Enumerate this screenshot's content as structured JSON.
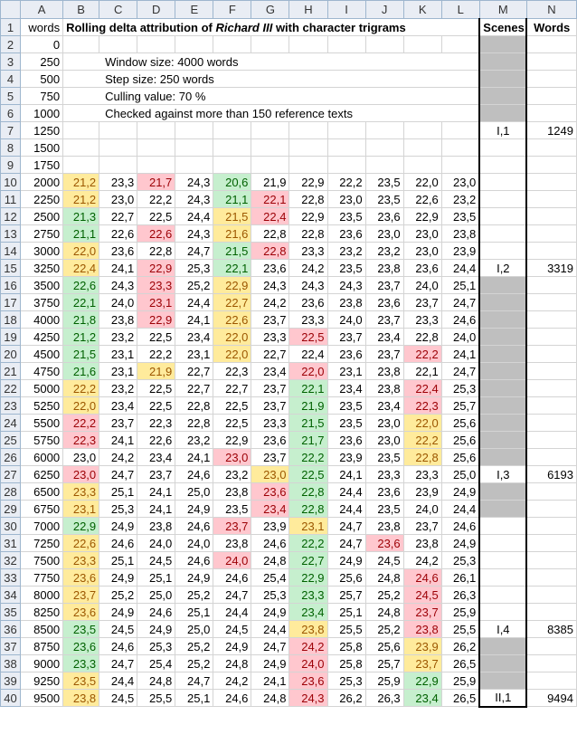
{
  "columns": [
    "A",
    "B",
    "C",
    "D",
    "E",
    "F",
    "G",
    "H",
    "I",
    "J",
    "K",
    "L",
    "M",
    "N"
  ],
  "header": {
    "words": "words",
    "title_pre": "Rolling delta attribution of ",
    "title_em": "Richard III",
    "title_post": " with character trigrams",
    "scenes": "Scenes",
    "words_col": "Words"
  },
  "notes": {
    "window": "Window size: 4000 words",
    "step": "Step size: 250 words",
    "culling": "Culling value: 70 %",
    "checked": "Checked against more than 150 reference texts"
  },
  "colors": {
    "green": "#c6efce",
    "yellow": "#ffeb9c",
    "red": "#ffc7ce",
    "grey": "#bfbfbf"
  },
  "rows": [
    {
      "n": "2",
      "w": "0",
      "v": [],
      "c": "",
      "scene": "",
      "sw": ""
    },
    {
      "n": "3",
      "w": "250",
      "v": [],
      "c": "",
      "scene": "",
      "sw": ""
    },
    {
      "n": "4",
      "w": "500",
      "v": [],
      "c": "",
      "scene": "",
      "sw": ""
    },
    {
      "n": "5",
      "w": "750",
      "v": [],
      "c": "",
      "scene": "",
      "sw": ""
    },
    {
      "n": "6",
      "w": "1000",
      "v": [],
      "c": "",
      "scene": "",
      "sw": ""
    },
    {
      "n": "7",
      "w": "1250",
      "v": [],
      "c": "",
      "scene": "I,1",
      "sw": "1249"
    },
    {
      "n": "8",
      "w": "1500",
      "v": [],
      "c": "",
      "scene": "",
      "sw": ""
    },
    {
      "n": "9",
      "w": "1750",
      "v": [],
      "c": "",
      "scene": "",
      "sw": ""
    },
    {
      "n": "10",
      "w": "2000",
      "v": [
        "21,2",
        "23,3",
        "21,7",
        "24,3",
        "20,6",
        "21,9",
        "22,9",
        "22,2",
        "23,5",
        "22,0",
        "23,0"
      ],
      "c": "y.r.g......",
      "scene": "",
      "sw": ""
    },
    {
      "n": "11",
      "w": "2250",
      "v": [
        "21,2",
        "23,0",
        "22,2",
        "24,3",
        "21,1",
        "22,1",
        "22,8",
        "23,0",
        "23,5",
        "22,6",
        "23,2"
      ],
      "c": "y...gr.....",
      "scene": "",
      "sw": ""
    },
    {
      "n": "12",
      "w": "2500",
      "v": [
        "21,3",
        "22,7",
        "22,5",
        "24,4",
        "21,5",
        "22,4",
        "22,9",
        "23,5",
        "23,6",
        "22,9",
        "23,5"
      ],
      "c": "g...yr.....",
      "scene": "",
      "sw": ""
    },
    {
      "n": "13",
      "w": "2750",
      "v": [
        "21,1",
        "22,6",
        "22,6",
        "24,3",
        "21,6",
        "22,8",
        "22,8",
        "23,6",
        "23,0",
        "23,0",
        "23,8"
      ],
      "c": "g.r.y......",
      "scene": "",
      "sw": ""
    },
    {
      "n": "14",
      "w": "3000",
      "v": [
        "22,0",
        "23,6",
        "22,8",
        "24,7",
        "21,5",
        "22,8",
        "23,3",
        "23,2",
        "23,2",
        "23,0",
        "23,9"
      ],
      "c": "y...gr.....",
      "scene": "",
      "sw": ""
    },
    {
      "n": "15",
      "w": "3250",
      "v": [
        "22,4",
        "24,1",
        "22,9",
        "25,3",
        "22,1",
        "23,6",
        "24,2",
        "23,5",
        "23,8",
        "23,6",
        "24,4"
      ],
      "c": "y.r.g......",
      "scene": "I,2",
      "sw": "3319"
    },
    {
      "n": "16",
      "w": "3500",
      "v": [
        "22,6",
        "24,3",
        "23,3",
        "25,2",
        "22,9",
        "24,3",
        "24,3",
        "24,3",
        "23,7",
        "24,0",
        "25,1"
      ],
      "c": "g.r.y......",
      "scene": "",
      "sw": ""
    },
    {
      "n": "17",
      "w": "3750",
      "v": [
        "22,1",
        "24,0",
        "23,1",
        "24,4",
        "22,7",
        "24,2",
        "23,6",
        "23,8",
        "23,6",
        "23,7",
        "24,7"
      ],
      "c": "g.r.y......",
      "scene": "",
      "sw": ""
    },
    {
      "n": "18",
      "w": "4000",
      "v": [
        "21,8",
        "23,8",
        "22,9",
        "24,1",
        "22,6",
        "23,7",
        "23,3",
        "24,0",
        "23,7",
        "23,3",
        "24,6"
      ],
      "c": "g.r.y......",
      "scene": "",
      "sw": ""
    },
    {
      "n": "19",
      "w": "4250",
      "v": [
        "21,2",
        "23,2",
        "22,5",
        "23,4",
        "22,0",
        "23,3",
        "22,5",
        "23,7",
        "23,4",
        "22,8",
        "24,0"
      ],
      "c": "g...y.r....",
      "scene": "",
      "sw": ""
    },
    {
      "n": "20",
      "w": "4500",
      "v": [
        "21,5",
        "23,1",
        "22,2",
        "23,1",
        "22,0",
        "22,7",
        "22,4",
        "23,6",
        "23,7",
        "22,2",
        "24,1"
      ],
      "c": "g...y....r.",
      "scene": "",
      "sw": ""
    },
    {
      "n": "21",
      "w": "4750",
      "v": [
        "21,6",
        "23,1",
        "21,9",
        "22,7",
        "22,3",
        "23,4",
        "22,0",
        "23,1",
        "23,8",
        "22,1",
        "24,7"
      ],
      "c": "g.y...r....",
      "scene": "",
      "sw": ""
    },
    {
      "n": "22",
      "w": "5000",
      "v": [
        "22,2",
        "23,2",
        "22,5",
        "22,7",
        "22,7",
        "23,7",
        "22,1",
        "23,4",
        "23,8",
        "22,4",
        "25,3"
      ],
      "c": "y.....g..r.",
      "scene": "",
      "sw": ""
    },
    {
      "n": "23",
      "w": "5250",
      "v": [
        "22,0",
        "23,4",
        "22,5",
        "22,8",
        "22,5",
        "23,7",
        "21,9",
        "23,5",
        "23,4",
        "22,3",
        "25,7"
      ],
      "c": "y.....g..r.",
      "scene": "",
      "sw": ""
    },
    {
      "n": "24",
      "w": "5500",
      "v": [
        "22,2",
        "23,7",
        "22,3",
        "22,8",
        "22,5",
        "23,3",
        "21,5",
        "23,5",
        "23,0",
        "22,0",
        "25,6"
      ],
      "c": "r.....g..y.",
      "scene": "",
      "sw": ""
    },
    {
      "n": "25",
      "w": "5750",
      "v": [
        "22,3",
        "24,1",
        "22,6",
        "23,2",
        "22,9",
        "23,6",
        "21,7",
        "23,6",
        "23,0",
        "22,2",
        "25,6"
      ],
      "c": "r.....g..y.",
      "scene": "",
      "sw": ""
    },
    {
      "n": "26",
      "w": "6000",
      "v": [
        "23,0",
        "24,2",
        "23,4",
        "24,1",
        "23,0",
        "23,7",
        "22,2",
        "23,9",
        "23,5",
        "22,8",
        "25,6"
      ],
      "c": "....r.g..y.",
      "scene": "",
      "sw": ""
    },
    {
      "n": "27",
      "w": "6250",
      "v": [
        "23,0",
        "24,7",
        "23,7",
        "24,6",
        "23,2",
        "23,0",
        "22,5",
        "24,1",
        "23,3",
        "23,3",
        "25,0"
      ],
      "c": "r....yg....",
      "scene": "I,3",
      "sw": "6193"
    },
    {
      "n": "28",
      "w": "6500",
      "v": [
        "23,3",
        "25,1",
        "24,1",
        "25,0",
        "23,8",
        "23,6",
        "22,8",
        "24,4",
        "23,6",
        "23,9",
        "24,9"
      ],
      "c": "y....rg....",
      "scene": "",
      "sw": ""
    },
    {
      "n": "29",
      "w": "6750",
      "v": [
        "23,1",
        "25,3",
        "24,1",
        "24,9",
        "23,5",
        "23,4",
        "22,8",
        "24,4",
        "23,5",
        "24,0",
        "24,4"
      ],
      "c": "y....rg....",
      "scene": "",
      "sw": ""
    },
    {
      "n": "30",
      "w": "7000",
      "v": [
        "22,9",
        "24,9",
        "23,8",
        "24,6",
        "23,7",
        "23,9",
        "23,1",
        "24,7",
        "23,8",
        "23,7",
        "24,6"
      ],
      "c": "g...r.y....",
      "scene": "",
      "sw": ""
    },
    {
      "n": "31",
      "w": "7250",
      "v": [
        "22,6",
        "24,6",
        "24,0",
        "24,0",
        "23,8",
        "24,6",
        "22,2",
        "24,7",
        "23,6",
        "23,8",
        "24,9"
      ],
      "c": "y.....g.r..",
      "scene": "",
      "sw": ""
    },
    {
      "n": "32",
      "w": "7500",
      "v": [
        "23,3",
        "25,1",
        "24,5",
        "24,6",
        "24,0",
        "24,8",
        "22,7",
        "24,9",
        "24,5",
        "24,2",
        "25,3"
      ],
      "c": "y...r.g....",
      "scene": "",
      "sw": ""
    },
    {
      "n": "33",
      "w": "7750",
      "v": [
        "23,6",
        "24,9",
        "25,1",
        "24,9",
        "24,6",
        "25,4",
        "22,9",
        "25,6",
        "24,8",
        "24,6",
        "26,1"
      ],
      "c": "y.....g..r.",
      "scene": "",
      "sw": ""
    },
    {
      "n": "34",
      "w": "8000",
      "v": [
        "23,7",
        "25,2",
        "25,0",
        "25,2",
        "24,7",
        "25,3",
        "23,3",
        "25,7",
        "25,2",
        "24,5",
        "26,3"
      ],
      "c": "y.....g..r.",
      "scene": "",
      "sw": ""
    },
    {
      "n": "35",
      "w": "8250",
      "v": [
        "23,6",
        "24,9",
        "24,6",
        "25,1",
        "24,4",
        "24,9",
        "23,4",
        "25,1",
        "24,8",
        "23,7",
        "25,9"
      ],
      "c": "y.....g..r.",
      "scene": "",
      "sw": ""
    },
    {
      "n": "36",
      "w": "8500",
      "v": [
        "23,5",
        "24,5",
        "24,9",
        "25,0",
        "24,5",
        "24,4",
        "23,8",
        "25,5",
        "25,2",
        "23,8",
        "25,5"
      ],
      "c": "g.....y..r.",
      "scene": "I,4",
      "sw": "8385"
    },
    {
      "n": "37",
      "w": "8750",
      "v": [
        "23,6",
        "24,6",
        "25,3",
        "25,2",
        "24,9",
        "24,7",
        "24,2",
        "25,8",
        "25,6",
        "23,9",
        "26,2"
      ],
      "c": "g.....r..y.",
      "scene": "",
      "sw": ""
    },
    {
      "n": "38",
      "w": "9000",
      "v": [
        "23,3",
        "24,7",
        "25,4",
        "25,2",
        "24,8",
        "24,9",
        "24,0",
        "25,8",
        "25,7",
        "23,7",
        "26,5"
      ],
      "c": "g.....r..y.",
      "scene": "",
      "sw": ""
    },
    {
      "n": "39",
      "w": "9250",
      "v": [
        "23,5",
        "24,4",
        "24,8",
        "24,7",
        "24,2",
        "24,1",
        "23,6",
        "25,3",
        "25,9",
        "22,9",
        "25,9"
      ],
      "c": "y.....r..g.",
      "scene": "",
      "sw": ""
    },
    {
      "n": "40",
      "w": "9500",
      "v": [
        "23,8",
        "24,5",
        "25,5",
        "25,1",
        "24,6",
        "24,8",
        "24,3",
        "26,2",
        "26,3",
        "23,4",
        "26,5"
      ],
      "c": "y.....r..g.",
      "scene": "II,1",
      "sw": "9494"
    }
  ]
}
